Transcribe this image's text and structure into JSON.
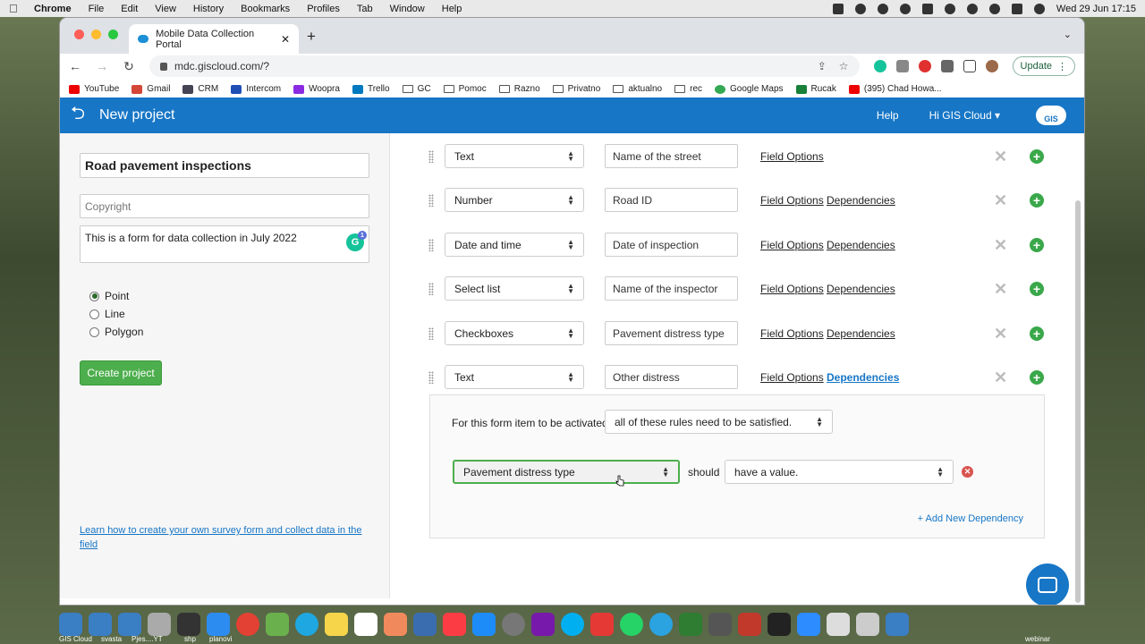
{
  "menubar": {
    "items": [
      "Chrome",
      "File",
      "Edit",
      "View",
      "History",
      "Bookmarks",
      "Profiles",
      "Tab",
      "Window",
      "Help"
    ],
    "datetime": "Wed 29 Jun  17:15"
  },
  "browser": {
    "tab_title": "Mobile Data Collection Portal",
    "url": "mdc.giscloud.com/?",
    "update_label": "Update",
    "bookmarks": [
      "YouTube",
      "Gmail",
      "CRM",
      "Intercom",
      "Woopra",
      "Trello",
      "GC",
      "Pomoc",
      "Razno",
      "Privatno",
      "aktualno",
      "rec",
      "Google Maps",
      "Rucak",
      "(395) Chad Howa..."
    ]
  },
  "app": {
    "header_title": "New project",
    "help": "Help",
    "user": "Hi GIS Cloud",
    "logo": "GIS"
  },
  "project": {
    "name": "Road pavement inspections",
    "copyright_placeholder": "Copyright",
    "description": "This is a form for data collection in July 2022",
    "grammarly_count": "1",
    "geometry_options": [
      "Point",
      "Line",
      "Polygon"
    ],
    "geometry_selected": "Point",
    "create_button": "Create project",
    "learn_link": "Learn how to create your own survey form and collect data in the field"
  },
  "form_rows": [
    {
      "type": "Text",
      "name": "Name of the street",
      "field_options": "Field Options",
      "dependencies": ""
    },
    {
      "type": "Number",
      "name": "Road ID",
      "field_options": "Field Options",
      "dependencies": "Dependencies"
    },
    {
      "type": "Date and time",
      "name": "Date of inspection",
      "field_options": "Field Options",
      "dependencies": "Dependencies"
    },
    {
      "type": "Select list",
      "name": "Name of the inspector",
      "field_options": "Field Options",
      "dependencies": "Dependencies"
    },
    {
      "type": "Checkboxes",
      "name": "Pavement distress type",
      "field_options": "Field Options",
      "dependencies": "Dependencies"
    },
    {
      "type": "Text",
      "name": "Other distress",
      "field_options": "Field Options",
      "dependencies": "Dependencies"
    }
  ],
  "dependency": {
    "activation_label": "For this form item to be activated",
    "activation_rule": "all of these rules need to be satisfied.",
    "field": "Pavement distress type",
    "should": "should",
    "condition": "have a value.",
    "add_new": "+ Add New Dependency"
  },
  "dock_labels": [
    "GIS Cloud",
    "svasta",
    "Pjes....YT",
    "shp",
    "planovi",
    "webinar"
  ]
}
